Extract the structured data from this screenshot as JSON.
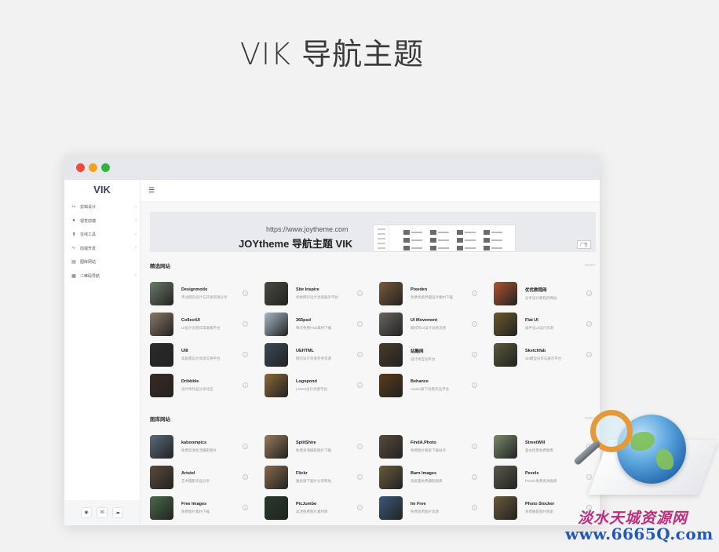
{
  "hero": {
    "title": "VIK 导航主题"
  },
  "app": {
    "logo": "VIK",
    "menu_icon": "☰",
    "sidebar": {
      "items": [
        {
          "icon": "✂",
          "label": "剪辑设计",
          "arrow": "›"
        },
        {
          "icon": "●",
          "label": "视觉前端",
          "arrow": "›"
        },
        {
          "icon": "⬆",
          "label": "在线工具",
          "arrow": "›"
        },
        {
          "icon": "‹›",
          "label": "前端开发",
          "arrow": "›"
        },
        {
          "icon": "▤",
          "label": "图库网站",
          "arrow": ""
        },
        {
          "icon": "▦",
          "label": "二维码导航",
          "arrow": "›"
        }
      ],
      "bottom_buttons": [
        "◉",
        "✉",
        "☁"
      ]
    },
    "banner": {
      "url": "https://www.joytheme.com",
      "title": "JOYtheme 导航主题 VIK",
      "ad_label": "广告"
    },
    "sections": [
      {
        "title": "精选网站",
        "more": "more+",
        "cards": [
          {
            "name": "Designmodo",
            "desc": "专注网页设计与开发资源分享",
            "info": "i"
          },
          {
            "name": "Site Inspire",
            "desc": "优秀网页设计灵感展示平台",
            "info": "i"
          },
          {
            "name": "Pixeden",
            "desc": "免费优质界面设计素材下载",
            "info": "i"
          },
          {
            "name": "优优教程网",
            "desc": "分享设计教程的网站",
            "info": "i"
          },
          {
            "name": "CollectUI",
            "desc": "UI设计灵感日常收集平台",
            "info": "i"
          },
          {
            "name": "365psd",
            "desc": "每天免费PSD素材下载",
            "info": "i"
          },
          {
            "name": "UI Movement",
            "desc": "最好的UI设计动效灵感",
            "info": "i"
          },
          {
            "name": "Flat UI",
            "desc": "扁平化UI设计资源",
            "info": "i"
          },
          {
            "name": "UI8",
            "desc": "高质量设计资源交易平台",
            "info": "i"
          },
          {
            "name": "UEHTML",
            "desc": "网页设计开发参考资源",
            "info": "i"
          },
          {
            "name": "站酷网",
            "desc": "设计师互动平台",
            "info": "i"
          },
          {
            "name": "Sketchfab",
            "desc": "3D模型分享与展示平台",
            "info": "i"
          },
          {
            "name": "Dribbble",
            "desc": "设计师作品分享社区",
            "info": "i"
          },
          {
            "name": "Logopond",
            "desc": "LOGO设计灵感平台",
            "info": "i"
          },
          {
            "name": "Behance",
            "desc": "Adobe旗下创意作品平台",
            "info": "i"
          }
        ]
      },
      {
        "title": "图库网站",
        "more": "more+",
        "cards": [
          {
            "name": "kaboompics",
            "desc": "免费高清生活摄影图片",
            "info": "i"
          },
          {
            "name": "SplitShire",
            "desc": "免费高清摄影图片下载",
            "info": "i"
          },
          {
            "name": "FindA.Photo",
            "desc": "免费图片搜索下载站点",
            "info": "i"
          },
          {
            "name": "StreetWill",
            "desc": "复古街景免费图库",
            "info": "i"
          },
          {
            "name": "Artstel",
            "desc": "艺术摄影作品分享",
            "info": "i"
          },
          {
            "name": "Flickr",
            "desc": "雅虎旗下图片分享网站",
            "info": "i"
          },
          {
            "name": "Barn Images",
            "desc": "高质量免费摄影图库",
            "info": "i"
          },
          {
            "name": "Pexels",
            "desc": "Pexels免费高清图库",
            "info": "i"
          },
          {
            "name": "Free Images",
            "desc": "免费图片素材下载",
            "info": "i"
          },
          {
            "name": "PicJumbo",
            "desc": "高清免费图片素材库",
            "info": "i"
          },
          {
            "name": "Im Free",
            "desc": "免费商用图片资源",
            "info": "i"
          },
          {
            "name": "Photo Stocker",
            "desc": "免费摄影图片搜索",
            "info": "i"
          }
        ]
      }
    ]
  },
  "watermark": {
    "line1": "淡水天城资源网",
    "line2": "www.6665Q.com"
  },
  "colors": {
    "accent": "#3b4261",
    "dot_red": "#ef4a3c",
    "dot_yellow": "#f0a31d",
    "dot_green": "#2fb441",
    "watermark_pink": "#c12a7d",
    "watermark_blue": "#2458b8"
  },
  "thumb_colors": [
    "#6b7b6a",
    "#4a4a42",
    "#7a5a3a",
    "#b0542e",
    "#8a7868",
    "#a8b8c8",
    "#6a6660",
    "#6a5a2c",
    "#2b2b2b",
    "#3a4a5a",
    "#4a3a2a",
    "#5a5a3a",
    "#3a2a22",
    "#8a6a3a",
    "#5a3a1a",
    "#5a6a7a",
    "#9a7a5a",
    "#5a4a3a",
    "#7a8a6a",
    "#5a4a3a",
    "#8a6a4a",
    "#6a5a3a",
    "#5a5a4a",
    "#4a6a4a",
    "#2a3a2a",
    "#3a5a7a",
    "#6a5a3a"
  ]
}
